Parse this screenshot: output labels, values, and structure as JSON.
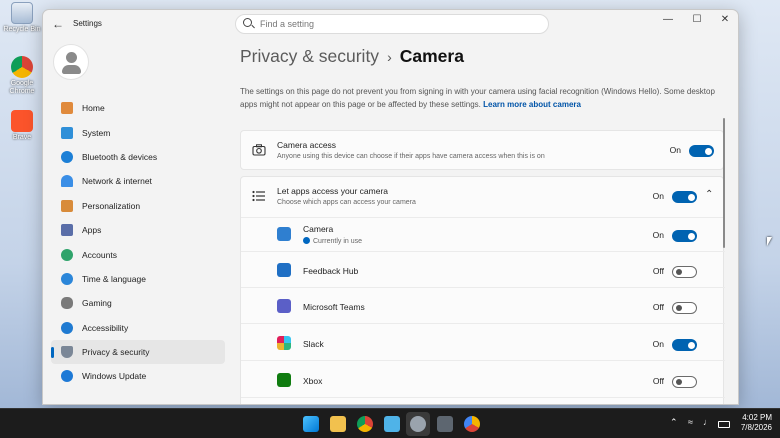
{
  "desktop": {
    "icons": [
      {
        "label": "Recycle Bin",
        "icon": "recycle-bin-icon"
      },
      {
        "label": "Google Chrome",
        "icon": "chrome-icon"
      },
      {
        "label": "Brave",
        "icon": "brave-icon"
      }
    ]
  },
  "window": {
    "title": "Settings",
    "search_placeholder": "Find a setting",
    "controls": {
      "minimize": "—",
      "maximize": "☐",
      "close": "✕"
    }
  },
  "sidebar": {
    "items": [
      {
        "label": "Home",
        "icon": "home-icon",
        "color": "#e08a3c"
      },
      {
        "label": "System",
        "icon": "system-icon",
        "color": "#2f8fd8"
      },
      {
        "label": "Bluetooth & devices",
        "icon": "bluetooth-icon",
        "color": "#1c7fd6"
      },
      {
        "label": "Network & internet",
        "icon": "wifi-icon",
        "color": "#3a8ee6"
      },
      {
        "label": "Personalization",
        "icon": "brush-icon",
        "color": "#d88b3a"
      },
      {
        "label": "Apps",
        "icon": "apps-icon",
        "color": "#5a6ea8"
      },
      {
        "label": "Accounts",
        "icon": "accounts-icon",
        "color": "#2fa36b"
      },
      {
        "label": "Time & language",
        "icon": "globe-icon",
        "color": "#2b86d9"
      },
      {
        "label": "Gaming",
        "icon": "gaming-icon",
        "color": "#7a7a7a"
      },
      {
        "label": "Accessibility",
        "icon": "accessibility-icon",
        "color": "#1f7ad1"
      },
      {
        "label": "Privacy & security",
        "icon": "shield-icon",
        "color": "#7b8797"
      },
      {
        "label": "Windows Update",
        "icon": "update-icon",
        "color": "#1d79d6"
      }
    ],
    "active_index": 10
  },
  "page": {
    "breadcrumb_parent": "Privacy & security",
    "breadcrumb_sep": "›",
    "title": "Camera",
    "description": "The settings on this page do not prevent you from signing in with your camera using facial recognition (Windows Hello). Some desktop apps might not appear on this page or be affected by these settings.",
    "learn_more": "Learn more about camera"
  },
  "camera_access": {
    "title": "Camera access",
    "subtitle": "Anyone using this device can choose if their apps have camera access when this is on",
    "state_label": "On",
    "enabled": true
  },
  "apps_access": {
    "title": "Let apps access your camera",
    "subtitle": "Choose which apps can access your camera",
    "state_label": "On",
    "enabled": true,
    "expanded": true,
    "apps": [
      {
        "name": "Camera",
        "status": "Currently in use",
        "state_label": "On",
        "enabled": true,
        "icon": "camera-app-icon",
        "color": "#2f7fd0"
      },
      {
        "name": "Feedback Hub",
        "status": "",
        "state_label": "Off",
        "enabled": false,
        "icon": "feedback-hub-icon",
        "color": "#1f6fc4"
      },
      {
        "name": "Microsoft Teams",
        "status": "",
        "state_label": "Off",
        "enabled": false,
        "icon": "teams-icon",
        "color": "#5b5fc7"
      },
      {
        "name": "Slack",
        "status": "",
        "state_label": "On",
        "enabled": true,
        "icon": "slack-icon",
        "color": "#e01e5a"
      },
      {
        "name": "Xbox",
        "status": "",
        "state_label": "Off",
        "enabled": false,
        "icon": "xbox-icon",
        "color": "#107c10"
      }
    ]
  },
  "taskbar": {
    "apps": [
      "windows-start-icon",
      "file-explorer-icon",
      "chrome-icon",
      "notepad-icon",
      "settings-icon",
      "camera-icon",
      "chrome-canary-icon"
    ],
    "time": "4:02 PM",
    "date": "7/8/2026"
  },
  "colors": {
    "accent": "#0063b1",
    "link": "#0054a8"
  }
}
